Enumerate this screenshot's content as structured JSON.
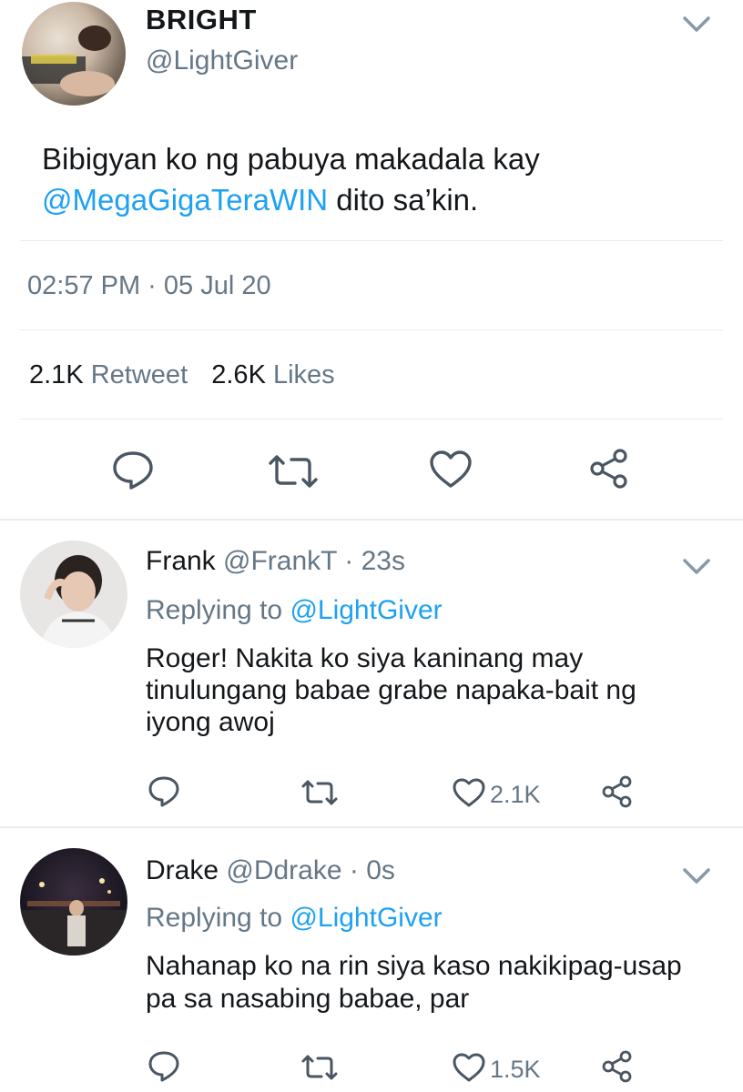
{
  "main_tweet": {
    "display_name": "BRIGHT",
    "handle": "@LightGiver",
    "text_line1": "Bibigyan ko ng pabuya makadala kay",
    "mention": "@MegaGigaTeraWIN",
    "text_line2_rest": " dito sa’kin.",
    "timestamp": "02:57 PM · 05 Jul 20",
    "retweet_count": "2.1K",
    "retweet_label": "Retweet",
    "like_count": "2.6K",
    "like_label": "Likes"
  },
  "replies": [
    {
      "display_name": "Frank",
      "handle": "@FrankT",
      "time": "· 23s",
      "replying_prefix": "Replying to ",
      "replying_handle": "@LightGiver",
      "lines": [
        "Roger! Nakita ko siya kaninang may",
        "tinulungang babae grabe napaka-bait ng",
        "iyong awoj"
      ],
      "like_count": "2.1K"
    },
    {
      "display_name": "Drake",
      "handle": "@Ddrake",
      "time": "· 0s",
      "replying_prefix": "Replying to ",
      "replying_handle": "@LightGiver",
      "lines": [
        "Nahanap ko na rin siya kaso nakikipag-usap",
        "pa sa nasabing babae, par"
      ],
      "like_count": "1.5K"
    }
  ],
  "icons": {
    "reply": "speech-bubble-icon",
    "retweet": "retweet-arrows-icon",
    "like": "heart-outline-icon",
    "share": "share-nodes-icon",
    "menu": "chevron-down-icon"
  },
  "colors": {
    "link": "#1da1f2",
    "secondary": "#657786",
    "text": "#14171a",
    "divider": "#e6ecf0"
  }
}
